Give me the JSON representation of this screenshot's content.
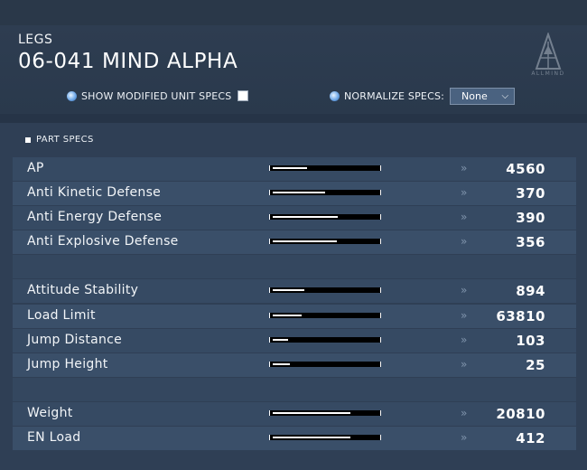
{
  "header": {
    "category": "LEGS",
    "part_name": "06-041 MIND ALPHA",
    "logo_text": "ALLMIND"
  },
  "options": {
    "show_modified_label": "SHOW MODIFIED UNIT SPECS",
    "show_modified_checked": false,
    "normalize_label": "NORMALIZE SPECS:",
    "normalize_value": "None"
  },
  "section": {
    "title": "PART SPECS"
  },
  "rows": [
    {
      "label": "AP",
      "value": "4560",
      "bar_fraction": 0.33
    },
    {
      "label": "Anti Kinetic Defense",
      "value": "370",
      "bar_fraction": 0.5
    },
    {
      "label": "Anti Energy Defense",
      "value": "390",
      "bar_fraction": 0.62
    },
    {
      "label": "Anti Explosive Defense",
      "value": "356",
      "bar_fraction": 0.61
    },
    {
      "label": "Attitude Stability",
      "value": "894",
      "bar_fraction": 0.3
    },
    {
      "label": "Load Limit",
      "value": "63810",
      "bar_fraction": 0.28
    },
    {
      "label": "Jump Distance",
      "value": "103",
      "bar_fraction": 0.15
    },
    {
      "label": "Jump Height",
      "value": "25",
      "bar_fraction": 0.16
    },
    {
      "label": "Weight",
      "value": "20810",
      "bar_fraction": 0.74
    },
    {
      "label": "EN Load",
      "value": "412",
      "bar_fraction": 0.74
    }
  ],
  "colors": {
    "background": "#2b3a4e",
    "row_a": "#364a63",
    "row_b": "#3a4f69",
    "bar_track": "#000000",
    "bar_fill": "#ffffff"
  }
}
